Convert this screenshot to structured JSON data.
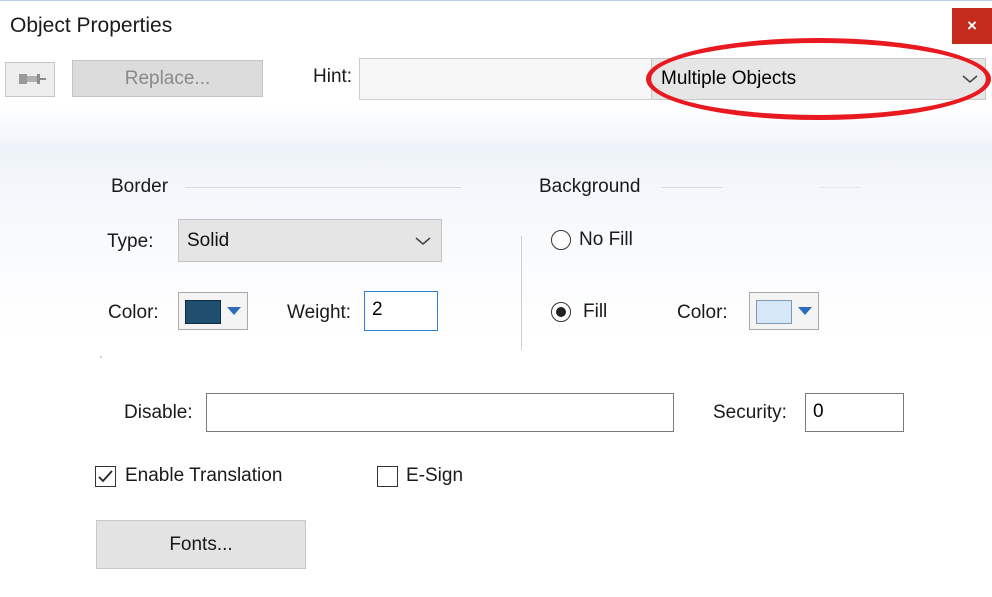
{
  "window": {
    "title": "Object Properties",
    "close_label": "×"
  },
  "toolbar": {
    "pin_icon": "pushpin-icon",
    "replace_label": "Replace...",
    "hint_label": "Hint:",
    "hint_value": "",
    "object_selector_value": "Multiple Objects"
  },
  "border": {
    "group_label": "Border",
    "type_label": "Type:",
    "type_value": "Solid",
    "color_label": "Color:",
    "color_value": "#1f4e6e",
    "weight_label": "Weight:",
    "weight_value": "2"
  },
  "background": {
    "group_label": "Background",
    "no_fill_label": "No Fill",
    "fill_label": "Fill",
    "selected": "Fill",
    "color_label": "Color:",
    "color_value": "#d6e8f7"
  },
  "disable": {
    "label": "Disable:",
    "value": ""
  },
  "security": {
    "label": "Security:",
    "value": "0"
  },
  "options": {
    "enable_translation_label": "Enable Translation",
    "enable_translation_checked": true,
    "esign_label": "E-Sign",
    "esign_checked": false
  },
  "fonts_button_label": "Fonts...",
  "annotation": {
    "color": "#e8191f"
  }
}
